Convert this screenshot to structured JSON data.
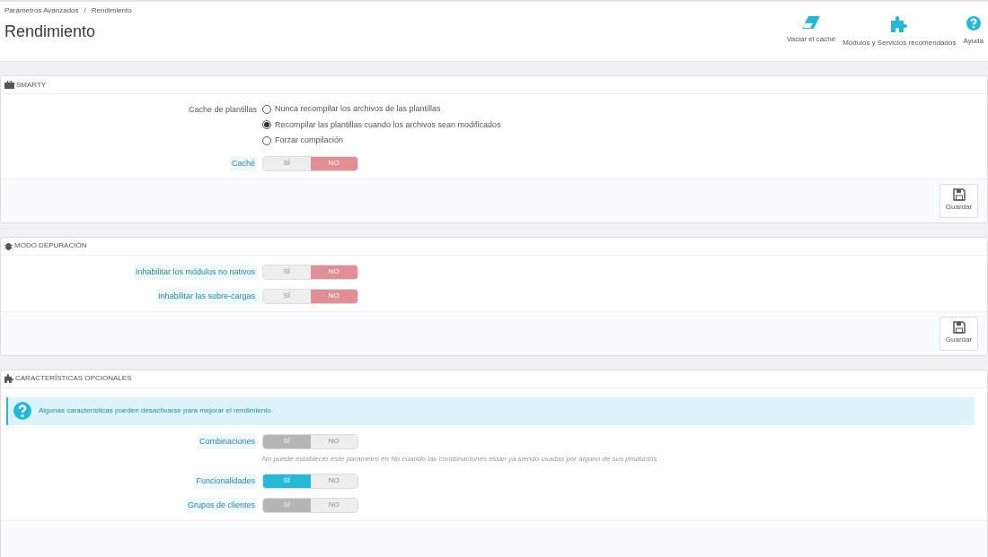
{
  "breadcrumb": [
    "Parámetros Avanzados",
    "Rendimiento"
  ],
  "breadcrumb_separator": "/",
  "page_title": "Rendimiento",
  "toolbar": [
    {
      "kind": "eraser",
      "label": "Vaciar el caché"
    },
    {
      "kind": "puzzle",
      "label": "Módulos y Servicios recomendados"
    },
    {
      "kind": "help",
      "label": "Ayuda"
    }
  ],
  "sections": [
    {
      "title": "SMARTY",
      "save": "Guardar",
      "fields": [
        {
          "kind": "radio",
          "label": "Cache de plantillas",
          "options": [
            {
              "label": "Nunca recompilar los archivos de las plantillas",
              "selected": false
            },
            {
              "label": "Recompilar las plantillas cuando los archivos sean modificados",
              "selected": true
            },
            {
              "label": "Forzar compilación",
              "selected": false
            }
          ]
        },
        {
          "kind": "switch",
          "label": "Caché",
          "disabled": false,
          "options": [
            {
              "label": "SÍ",
              "selected": false
            },
            {
              "label": "NO",
              "selected": true
            }
          ]
        }
      ]
    },
    {
      "title": "MODO DEPURACIÓN",
      "save": "Guardar",
      "fields": [
        {
          "kind": "switch",
          "label": "Inhabilitar los módulos no nativos",
          "disabled": false,
          "options": [
            {
              "label": "SÍ",
              "selected": false
            },
            {
              "label": "NO",
              "selected": true
            }
          ]
        },
        {
          "kind": "switch",
          "label": "Inhabilitar las sobre-cargas",
          "disabled": false,
          "options": [
            {
              "label": "SÍ",
              "selected": false
            },
            {
              "label": "NO",
              "selected": true
            }
          ]
        }
      ]
    },
    {
      "title": "CARACTERÍSTICAS OPCIONALES",
      "alert": "Algunas características pueden desactivarse para mejorar el rendimiento.",
      "fields": [
        {
          "kind": "switch",
          "label": "Combinaciones",
          "disabled": true,
          "options": [
            {
              "label": "SÍ",
              "selected": true
            },
            {
              "label": "NO",
              "selected": false
            }
          ],
          "help": "No puede establecer este parámetro en No cuando las combinaciones están ya siendo usadas por alguno de sus productos"
        },
        {
          "kind": "switch",
          "label": "Funcionalidades",
          "disabled": false,
          "options": [
            {
              "label": "SÍ",
              "selected": true
            },
            {
              "label": "NO",
              "selected": false
            }
          ]
        },
        {
          "kind": "switch",
          "label": "Grupos de clientes",
          "disabled": true,
          "options": [
            {
              "label": "SÍ",
              "selected": true
            },
            {
              "label": "NO",
              "selected": false
            }
          ]
        }
      ]
    }
  ]
}
